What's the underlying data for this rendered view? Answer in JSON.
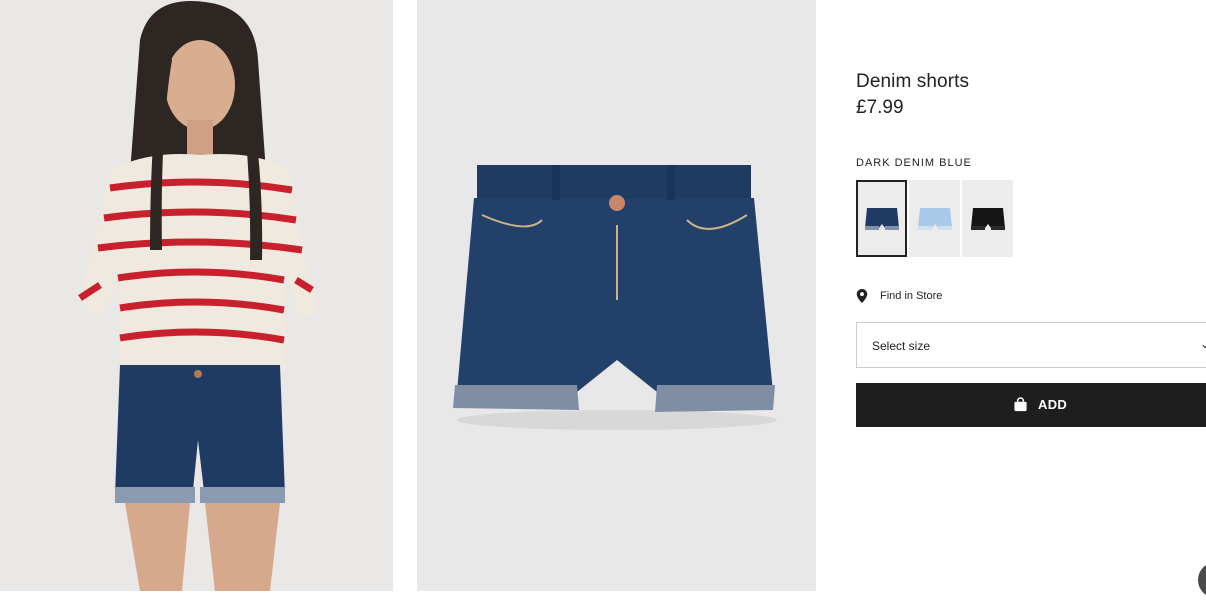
{
  "product": {
    "name": "Denim shorts",
    "price": "£7.99",
    "color_name": "DARK DENIM BLUE"
  },
  "images": {
    "model_photo_icon": "model-photo",
    "product_photo_icon": "product-photo"
  },
  "swatches": [
    {
      "name": "dark-denim-blue",
      "color": "#1f3a63",
      "selected": true
    },
    {
      "name": "light-denim-blue",
      "color": "#a9c9e8",
      "selected": false
    },
    {
      "name": "black",
      "color": "#151515",
      "selected": false
    }
  ],
  "find_in_store": {
    "label": "Find in Store",
    "icon": "location-pin-icon"
  },
  "size_select": {
    "placeholder": "Select size",
    "icon": "chevron-down-icon"
  },
  "add_button": {
    "label": "ADD",
    "icon": "bag-icon"
  },
  "colors": {
    "button_bg": "#1e1e1e",
    "background": "#ffffff",
    "photo_bg": "#e8e8e8"
  }
}
